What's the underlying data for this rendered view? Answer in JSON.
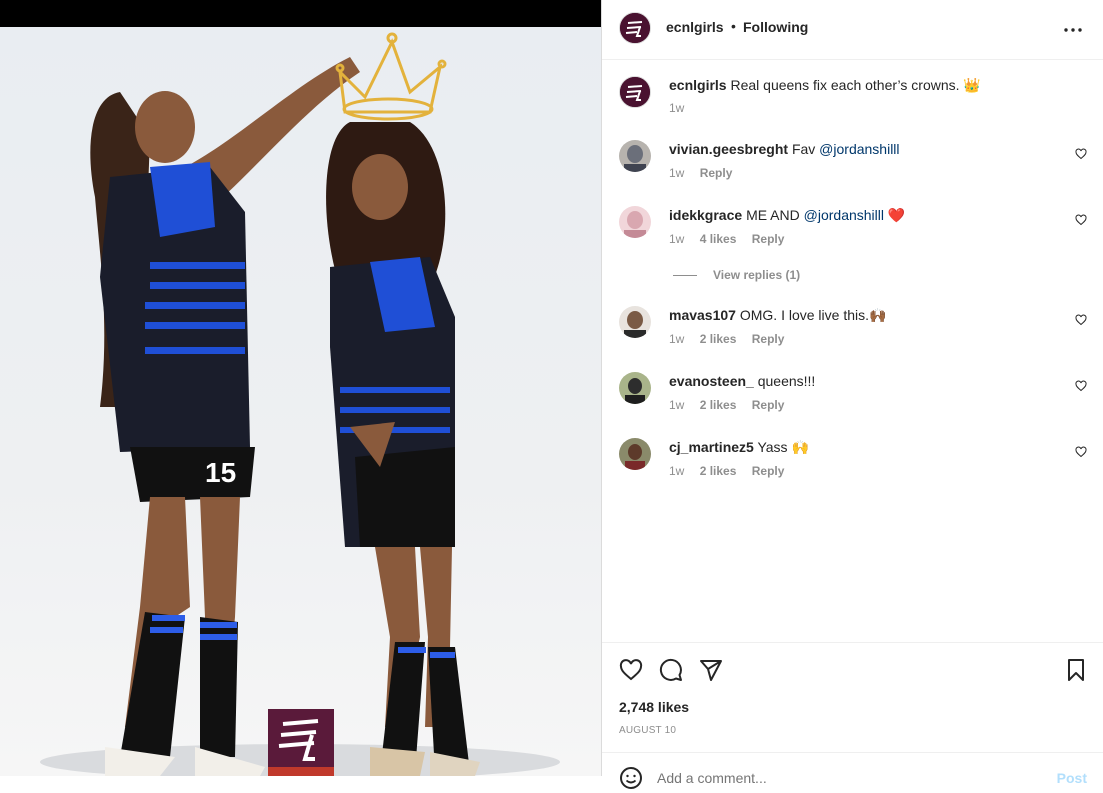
{
  "header": {
    "username": "ecnlgirls",
    "separator": "•",
    "follow_state": "Following"
  },
  "caption": {
    "username": "ecnlgirls",
    "text": "Real queens fix each other’s crowns. 👑",
    "time": "1w"
  },
  "comments": [
    {
      "username": "vivian.geesbreght",
      "before": "Fav ",
      "mention": "@jordanshilll",
      "after": "",
      "time": "1w",
      "likes": "",
      "reply": "Reply",
      "avatar_color": "#6b6f7a"
    },
    {
      "username": "idekkgrace",
      "before": "ME AND ",
      "mention": "@jordanshilll",
      "after": " ❤️",
      "time": "1w",
      "likes": "4 likes",
      "reply": "Reply",
      "avatar_color": "#d9a7b0"
    },
    {
      "username": "mavas107",
      "before": "OMG. I love live this.🙌🏾",
      "mention": "",
      "after": "",
      "time": "1w",
      "likes": "2 likes",
      "reply": "Reply",
      "avatar_color": "#7a5a45"
    },
    {
      "username": "evanosteen_",
      "before": "queens!!!",
      "mention": "",
      "after": "",
      "time": "1w",
      "likes": "2 likes",
      "reply": "Reply",
      "avatar_color": "#6d7a4e"
    },
    {
      "username": "cj_martinez5",
      "before": "Yass 🙌",
      "mention": "",
      "after": "",
      "time": "1w",
      "likes": "2 likes",
      "reply": "Reply",
      "avatar_color": "#5d5a3e"
    }
  ],
  "view_replies": "View replies (1)",
  "footer": {
    "likes": "2,748 likes",
    "date": "AUGUST 10",
    "add_comment_placeholder": "Add a comment...",
    "post_label": "Post"
  },
  "icons": {
    "more": "more-horizontal-icon",
    "like": "heart-icon",
    "comment": "comment-icon",
    "share": "send-icon",
    "save": "bookmark-icon",
    "emoji": "emoji-icon"
  },
  "colors": {
    "brand": "#4a1230",
    "mention": "#00376b",
    "muted": "#8e8e8e",
    "post_disabled": "#b2dffc"
  }
}
